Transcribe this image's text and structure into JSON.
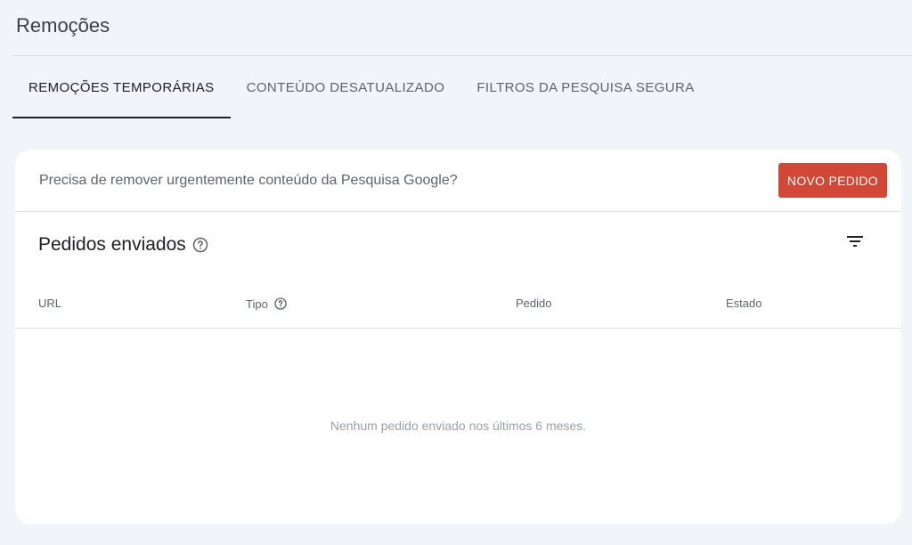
{
  "page": {
    "title": "Remoções"
  },
  "tabs": [
    {
      "label": "REMOÇÕES TEMPORÁRIAS",
      "active": true
    },
    {
      "label": "CONTEÚDO DESATUALIZADO",
      "active": false
    },
    {
      "label": "FILTROS DA PESQUISA SEGURA",
      "active": false
    }
  ],
  "banner": {
    "text": "Precisa de remover urgentemente conteúdo da Pesquisa Google?",
    "button_label": "NOVO PEDIDO"
  },
  "section": {
    "title": "Pedidos enviados"
  },
  "table": {
    "columns": [
      "URL",
      "Tipo",
      "Pedido",
      "Estado"
    ],
    "empty_message": "Nenhum pedido enviado nos últimos 6 meses."
  },
  "colors": {
    "accent_button": "#d14836",
    "background": "#f1f4f9",
    "card": "#ffffff"
  },
  "icons": {
    "section_help": "help-circle-icon",
    "column_help": "help-circle-icon",
    "filter": "filter-list-icon"
  }
}
